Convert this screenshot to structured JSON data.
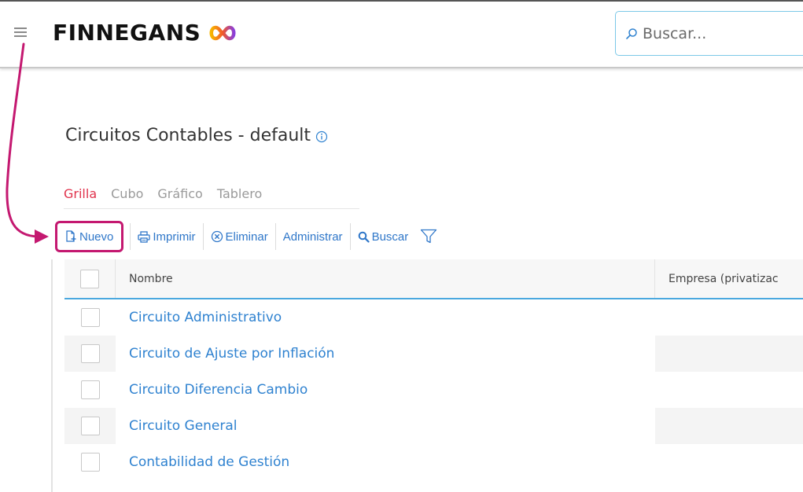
{
  "header": {
    "logo_text": "FINNEGANS",
    "search_placeholder": "Buscar..."
  },
  "page": {
    "title": "Circuitos Contables - default"
  },
  "view_tabs": [
    {
      "label": "Grilla",
      "active": true
    },
    {
      "label": "Cubo",
      "active": false
    },
    {
      "label": "Gráfico",
      "active": false
    },
    {
      "label": "Tablero",
      "active": false
    }
  ],
  "toolbar": {
    "nuevo": "Nuevo",
    "imprimir": "Imprimir",
    "eliminar": "Eliminar",
    "administrar": "Administrar",
    "buscar": "Buscar"
  },
  "table": {
    "columns": [
      "Nombre",
      "Empresa (privatizac"
    ],
    "rows": [
      {
        "nombre": "Circuito Administrativo",
        "empresa": ""
      },
      {
        "nombre": "Circuito de Ajuste por Inflación",
        "empresa": ""
      },
      {
        "nombre": "Circuito Diferencia Cambio",
        "empresa": ""
      },
      {
        "nombre": "Circuito General",
        "empresa": ""
      },
      {
        "nombre": "Contabilidad de Gestión",
        "empresa": ""
      }
    ]
  },
  "colors": {
    "accent_red": "#e0314b",
    "link_blue": "#2f82d0",
    "highlight_magenta": "#c41870",
    "header_underline_blue": "#4aa8df"
  }
}
